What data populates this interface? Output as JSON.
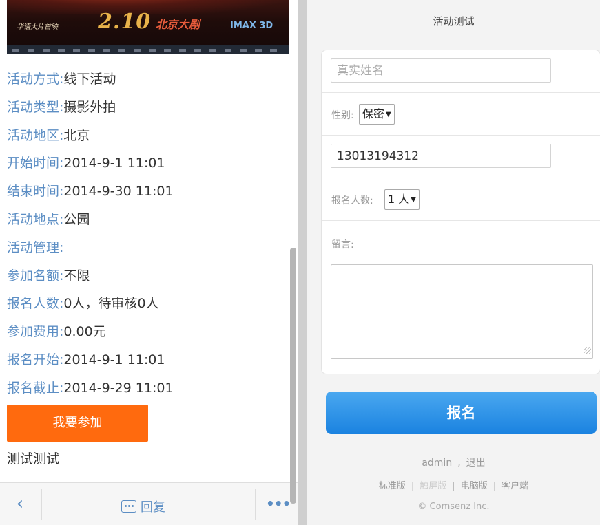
{
  "banner": {
    "date_text": "2.10",
    "title_text": "北京大剧",
    "slogan_text": "华语大片首映",
    "imax_text": "IMAX 3D"
  },
  "activity": {
    "rows": [
      {
        "label": "活动方式:",
        "value": "线下活动"
      },
      {
        "label": "活动类型:",
        "value": "摄影外拍"
      },
      {
        "label": "活动地区:",
        "value": "北京"
      },
      {
        "label": "开始时间:",
        "value": "2014-9-1 11:01"
      },
      {
        "label": "结束时间:",
        "value": "2014-9-30 11:01"
      },
      {
        "label": "活动地点:",
        "value": "公园"
      },
      {
        "label": "活动管理:",
        "value": ""
      },
      {
        "label": "参加名额:",
        "value": "不限"
      },
      {
        "label": "报名人数:",
        "value": "0人，待审核0人"
      },
      {
        "label": "参加费用:",
        "value": "0.00元"
      },
      {
        "label": "报名开始:",
        "value": "2014-9-1 11:01"
      },
      {
        "label": "报名截止:",
        "value": "2014-9-29 11:01"
      }
    ],
    "join_button_label": "我要参加",
    "description": "测试测试"
  },
  "bottom_bar": {
    "back_icon": "chevron-left-icon",
    "reply_icon": "comment-icon",
    "reply_label": "回复",
    "more_icon": "more-dots-icon",
    "more_glyph": "•••"
  },
  "form": {
    "page_title": "活动测试",
    "name_placeholder": "真实姓名",
    "gender_label": "性别:",
    "gender_selected": "保密",
    "phone_value": "13013194312",
    "count_label": "报名人数:",
    "count_selected": "1 人",
    "message_label": "留言:",
    "submit_label": "报名"
  },
  "footer": {
    "username": "admin",
    "separator": ",",
    "logout": "退出",
    "links": [
      "标准版",
      "触屏版",
      "电脑版",
      "客户端"
    ],
    "copyright": "© Comsenz Inc."
  },
  "colors": {
    "label_blue": "#5c8ec4",
    "join_orange": "#ff6a0e",
    "submit_blue": "#1a82e0"
  }
}
